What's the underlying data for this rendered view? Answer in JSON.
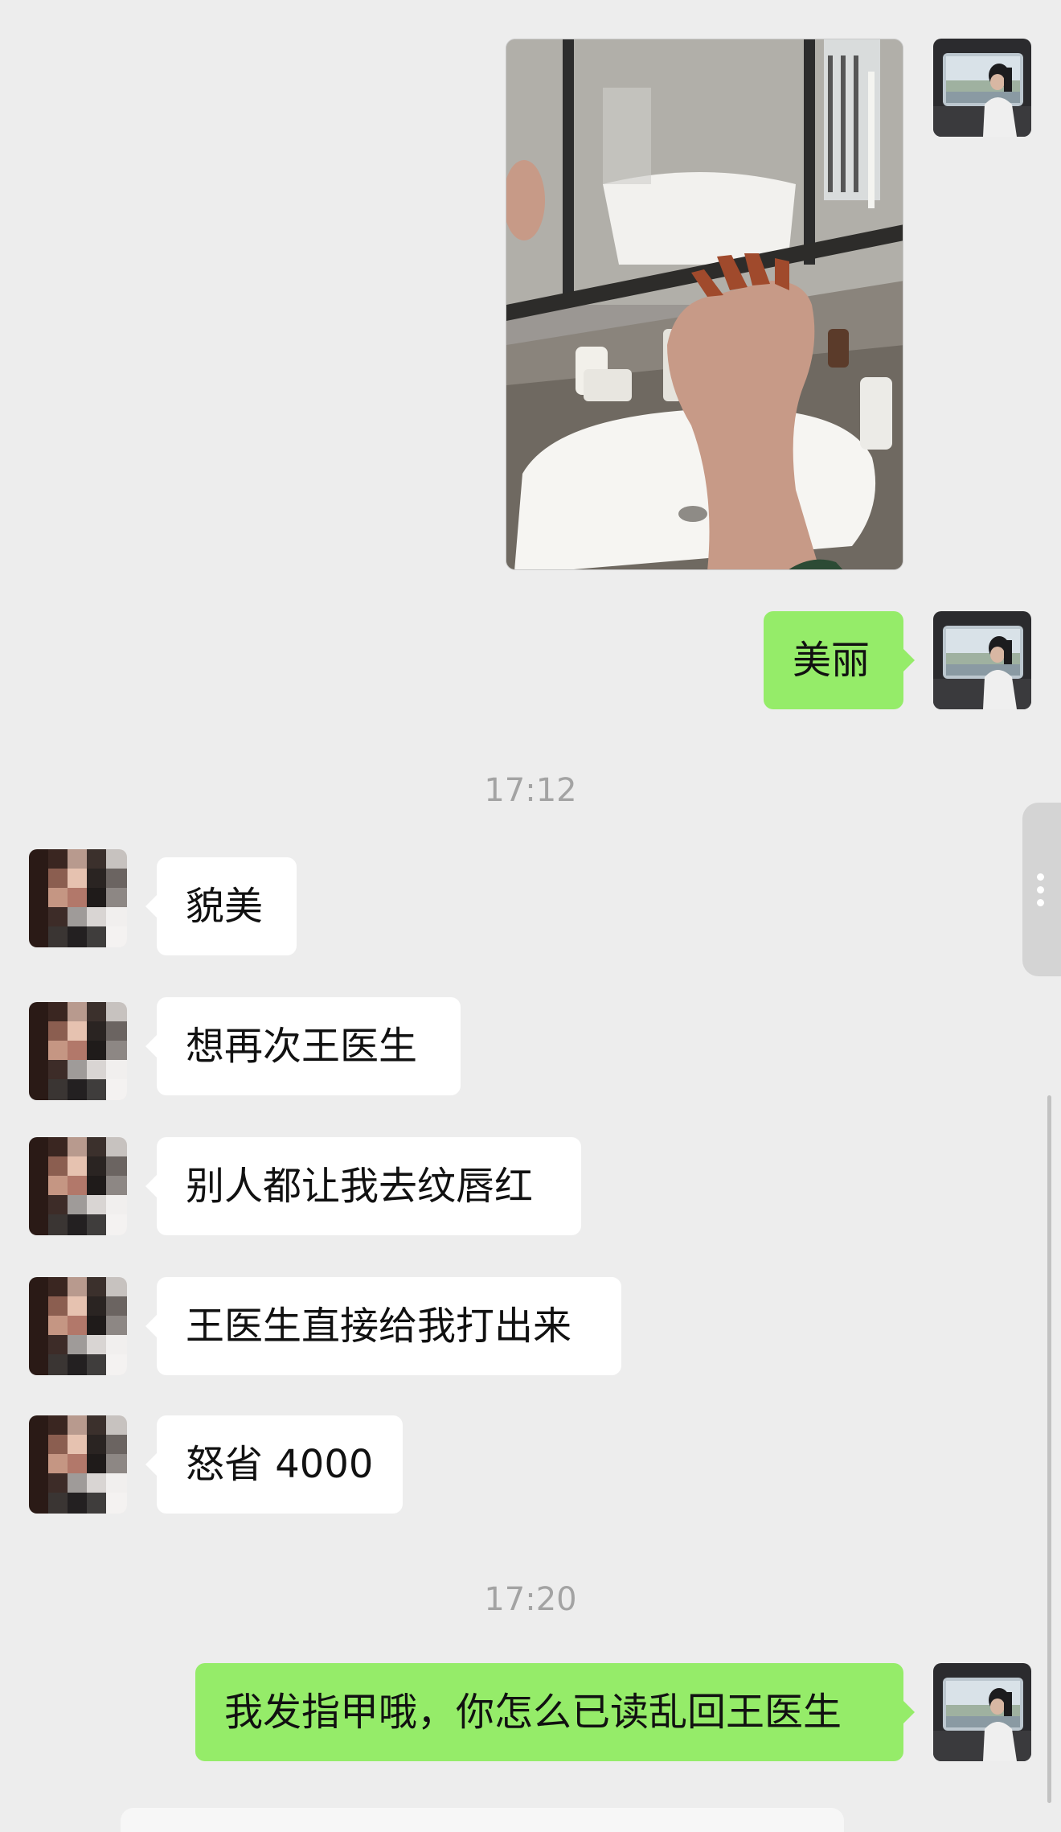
{
  "messages": {
    "self_1": "美丽",
    "peer_1": "貌美",
    "peer_2": "想再次王医生",
    "peer_3": "别人都让我去纹唇红",
    "peer_4": "王医生直接给我打出来",
    "peer_5": "怒省 4000",
    "self_2": "我发指甲哦，你怎么已读乱回王医生"
  },
  "timestamps": {
    "first": "17:12",
    "second": "17:20"
  },
  "colors": {
    "background": "#ededed",
    "self_bubble": "#95ec69",
    "peer_bubble": "#ffffff",
    "timestamp_text": "#a3a3a3"
  },
  "icons": {
    "side_handle": "more-vertical-icon"
  }
}
